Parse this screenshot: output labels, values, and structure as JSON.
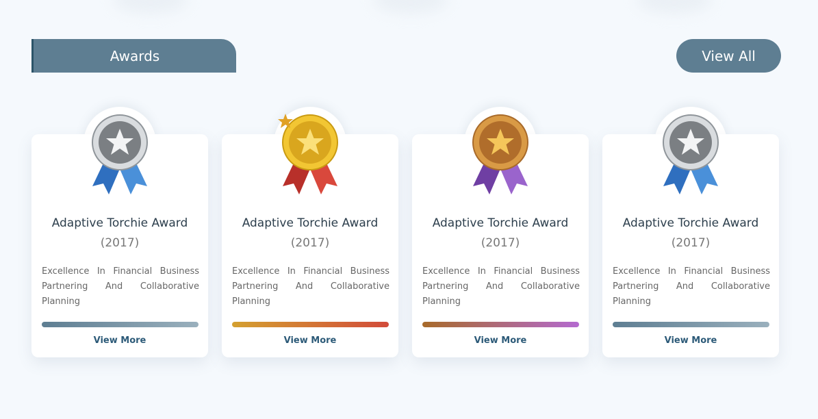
{
  "section": {
    "title": "Awards",
    "view_all_label": "View All"
  },
  "cards": [
    {
      "title": "Adaptive Torchie Award",
      "year": "(2017)",
      "description": "Excellence In Financial Business Partnering And Collaborative Planning",
      "view_more_label": "View More",
      "medal": "silver",
      "medal_icon": "silver-medal-icon",
      "bar_colors": [
        "#5e7e92",
        "#9ab0bd"
      ]
    },
    {
      "title": "Adaptive Torchie Award",
      "year": "(2017)",
      "description": "Excellence In Financial Business Partnering And Collaborative Planning",
      "view_more_label": "View More",
      "medal": "gold",
      "medal_icon": "gold-medal-icon",
      "bar_colors": [
        "#d4a030",
        "#d24b3a"
      ]
    },
    {
      "title": "Adaptive Torchie Award",
      "year": "(2017)",
      "description": "Excellence In Financial Business Partnering And Collaborative Planning",
      "view_more_label": "View More",
      "medal": "bronze",
      "medal_icon": "bronze-medal-icon",
      "bar_colors": [
        "#a86a2a",
        "#b46ad0"
      ]
    },
    {
      "title": "Adaptive Torchie Award",
      "year": "(2017)",
      "description": "Excellence In Financial Business Partnering And Collaborative Planning",
      "view_more_label": "View More",
      "medal": "silver",
      "medal_icon": "silver-medal-icon",
      "bar_colors": [
        "#5e7e92",
        "#9ab0bd"
      ]
    }
  ]
}
